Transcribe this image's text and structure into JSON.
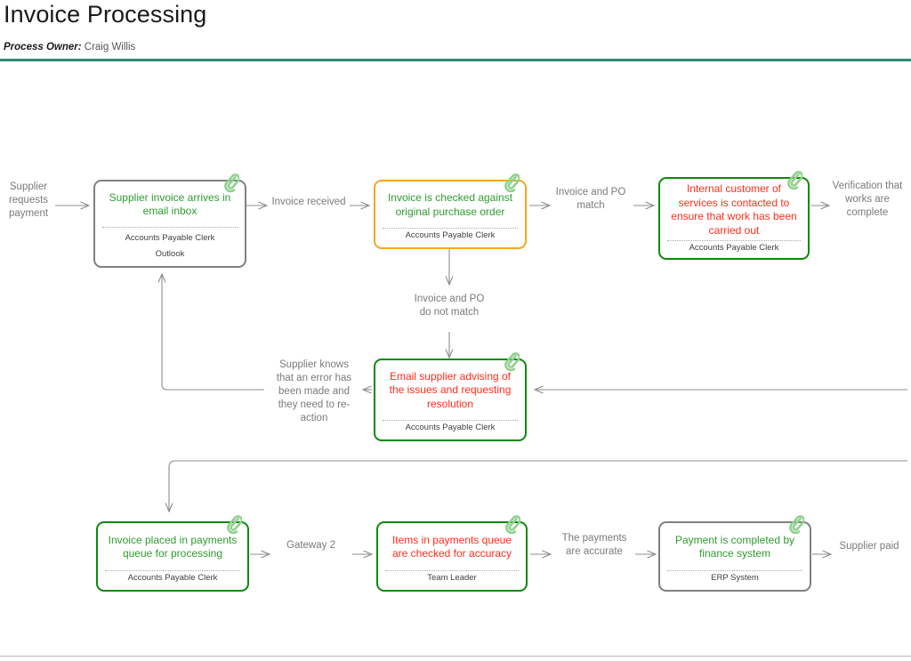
{
  "header": {
    "title": "Invoice Processing",
    "owner_label": "Process Owner:",
    "owner_value": "Craig Willis",
    "accent_color": "#2e8b74"
  },
  "colors": {
    "border_gray": "#808080",
    "border_green": "#0a8a0a",
    "border_orange": "#f5a623",
    "text_green": "#2f9c2f",
    "text_red": "#ff2d1a",
    "label_gray": "#7a7a7a",
    "connector_gray": "#8c8c8c"
  },
  "nodes": [
    {
      "id": "supplier-invoice-arrives",
      "title": "Supplier invoice arrives in email inbox",
      "role": "Accounts Payable Clerk",
      "system": "Outlook",
      "border": "gray",
      "text": "green",
      "attachment": "paperclip-icon"
    },
    {
      "id": "invoice-checked-against-po",
      "title": "Invoice is checked against original purchase order",
      "role": "Accounts Payable Clerk",
      "system": "",
      "border": "orange",
      "text": "green",
      "attachment": "paperclip-icon"
    },
    {
      "id": "internal-customer-contacted",
      "title": "Internal customer of services is contacted to ensure that work has been carried out",
      "role": "Accounts Payable Clerk",
      "system": "",
      "border": "green",
      "text": "red",
      "attachment": "paperclip-icon"
    },
    {
      "id": "email-supplier-advising",
      "title": "Email supplier advising of the issues and requesting resolution",
      "role": "Accounts Payable Clerk",
      "system": "",
      "border": "green",
      "text": "red",
      "attachment": "paperclip-icon"
    },
    {
      "id": "invoice-placed-in-queue",
      "title": "Invoice placed in payments queue for processing",
      "role": "Accounts Payable Clerk",
      "system": "",
      "border": "green",
      "text": "green",
      "attachment": "paperclip-icon"
    },
    {
      "id": "items-checked-for-accuracy",
      "title": "Items in payments queue are checked for accuracy",
      "role": "Team Leader",
      "system": "",
      "border": "green",
      "text": "red",
      "attachment": "paperclip-icon"
    },
    {
      "id": "payment-completed",
      "title": "Payment is completed by finance system",
      "role": "ERP System",
      "system": "",
      "border": "gray",
      "text": "green",
      "attachment": "paperclip-icon"
    }
  ],
  "edge_labels": [
    {
      "id": "supplier-requests-payment",
      "text": "Supplier\nrequests\npayment"
    },
    {
      "id": "invoice-received",
      "text": "Invoice received"
    },
    {
      "id": "invoice-and-po-match",
      "text": "Invoice and PO\nmatch"
    },
    {
      "id": "verification-works-complete",
      "text": "Verification that\nworks are\ncomplete"
    },
    {
      "id": "invoice-and-po-do-not-match",
      "text": "Invoice and PO\ndo not match"
    },
    {
      "id": "supplier-knows-error",
      "text": "Supplier knows\nthat an error has\nbeen made and\nthey need to re-\naction"
    },
    {
      "id": "gateway-2",
      "text": "Gateway 2"
    },
    {
      "id": "the-payments-are-accurate",
      "text": "The payments\nare accurate"
    },
    {
      "id": "supplier-paid",
      "text": "Supplier paid"
    }
  ]
}
